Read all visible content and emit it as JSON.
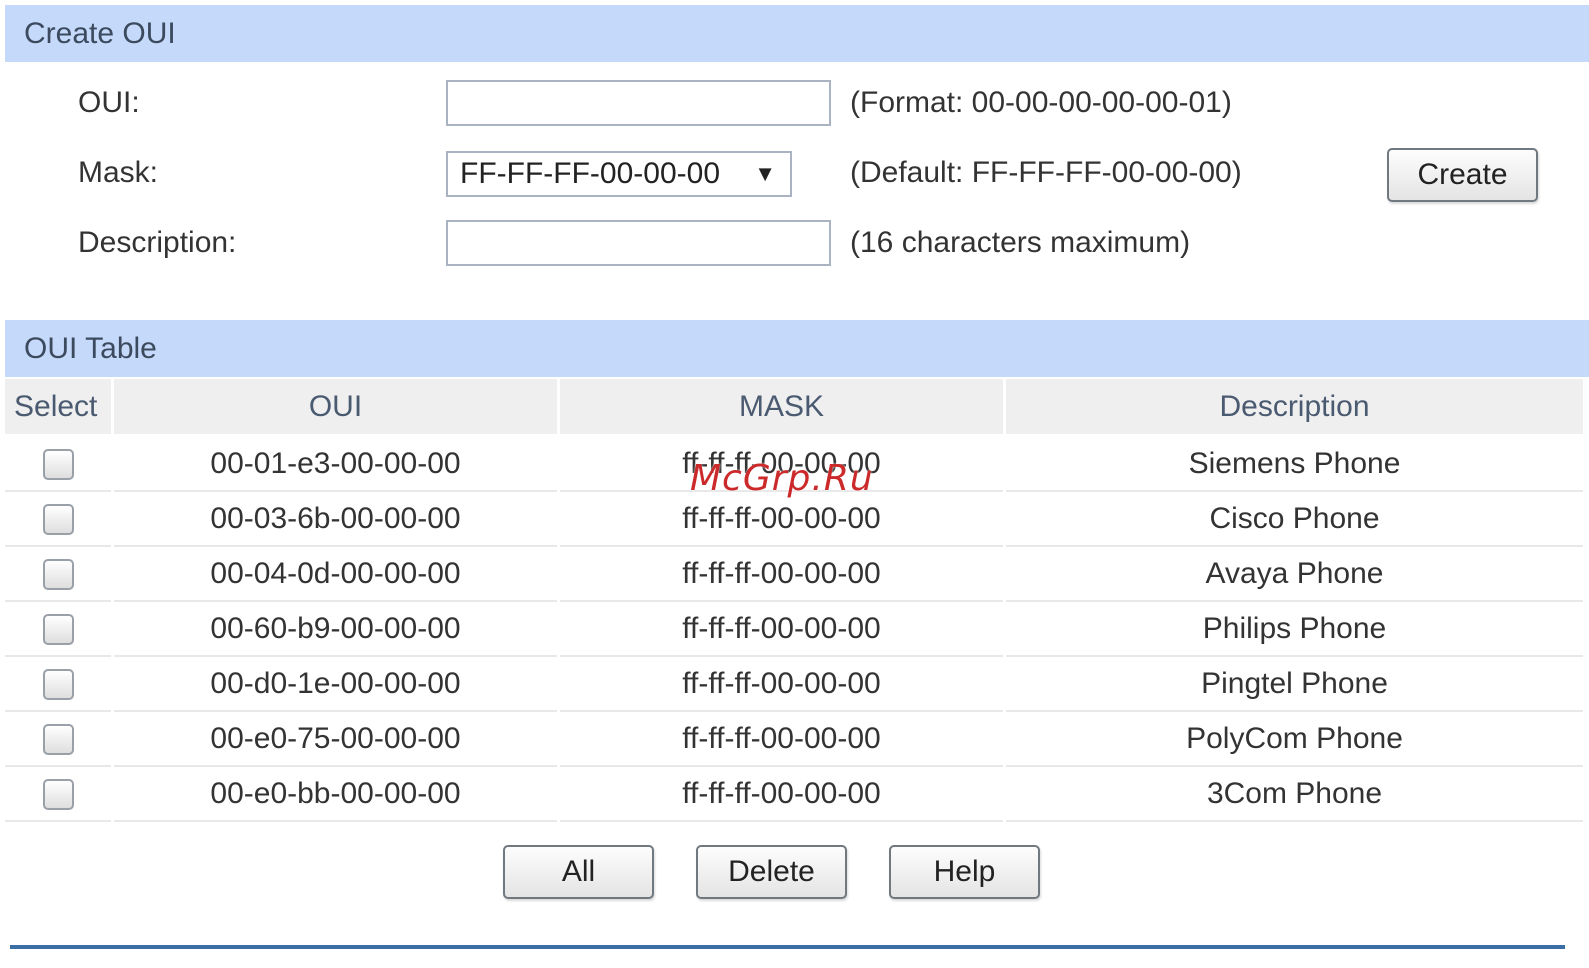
{
  "create_section": {
    "title": "Create OUI",
    "oui_label": "OUI:",
    "oui_value": "",
    "oui_hint": "(Format: 00-00-00-00-00-01)",
    "mask_label": "Mask:",
    "mask_selected": "FF-FF-FF-00-00-00",
    "mask_arrow": "▼",
    "mask_hint": "(Default: FF-FF-FF-00-00-00)",
    "description_label": "Description:",
    "description_value": "",
    "description_hint": "(16 characters maximum)",
    "create_button": "Create"
  },
  "table_section": {
    "title": "OUI Table",
    "columns": [
      "Select",
      "OUI",
      "MASK",
      "Description"
    ],
    "rows": [
      {
        "checked": false,
        "oui": "00-01-e3-00-00-00",
        "mask": "ff-ff-ff-00-00-00",
        "description": "Siemens Phone"
      },
      {
        "checked": false,
        "oui": "00-03-6b-00-00-00",
        "mask": "ff-ff-ff-00-00-00",
        "description": "Cisco Phone"
      },
      {
        "checked": false,
        "oui": "00-04-0d-00-00-00",
        "mask": "ff-ff-ff-00-00-00",
        "description": "Avaya Phone"
      },
      {
        "checked": false,
        "oui": "00-60-b9-00-00-00",
        "mask": "ff-ff-ff-00-00-00",
        "description": "Philips Phone"
      },
      {
        "checked": false,
        "oui": "00-d0-1e-00-00-00",
        "mask": "ff-ff-ff-00-00-00",
        "description": "Pingtel Phone"
      },
      {
        "checked": false,
        "oui": "00-e0-75-00-00-00",
        "mask": "ff-ff-ff-00-00-00",
        "description": "PolyCom Phone"
      },
      {
        "checked": false,
        "oui": "00-e0-bb-00-00-00",
        "mask": "ff-ff-ff-00-00-00",
        "description": "3Com Phone"
      }
    ]
  },
  "actions": {
    "all_button": "All",
    "delete_button": "Delete",
    "help_button": "Help"
  },
  "watermark": "McGrp.Ru",
  "colors": {
    "section_header_bg": "#c5d9fb",
    "table_header_bg": "#efefef",
    "bottom_rule": "#3a6ea5",
    "watermark": "#cc2a2a"
  }
}
